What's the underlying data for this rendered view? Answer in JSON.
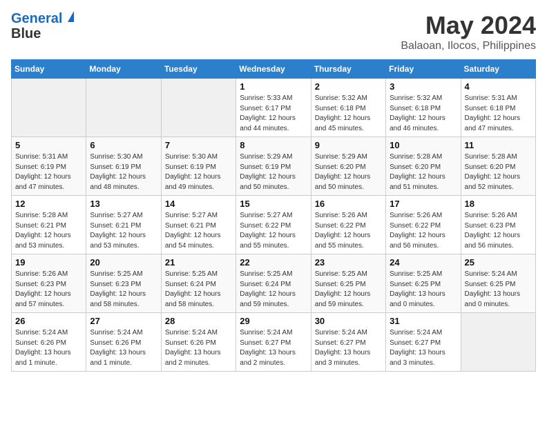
{
  "header": {
    "logo_line1": "General",
    "logo_line2": "Blue",
    "month": "May 2024",
    "location": "Balaoan, Ilocos, Philippines"
  },
  "days_of_week": [
    "Sunday",
    "Monday",
    "Tuesday",
    "Wednesday",
    "Thursday",
    "Friday",
    "Saturday"
  ],
  "weeks": [
    [
      {
        "num": "",
        "info": ""
      },
      {
        "num": "",
        "info": ""
      },
      {
        "num": "",
        "info": ""
      },
      {
        "num": "1",
        "info": "Sunrise: 5:33 AM\nSunset: 6:17 PM\nDaylight: 12 hours\nand 44 minutes."
      },
      {
        "num": "2",
        "info": "Sunrise: 5:32 AM\nSunset: 6:18 PM\nDaylight: 12 hours\nand 45 minutes."
      },
      {
        "num": "3",
        "info": "Sunrise: 5:32 AM\nSunset: 6:18 PM\nDaylight: 12 hours\nand 46 minutes."
      },
      {
        "num": "4",
        "info": "Sunrise: 5:31 AM\nSunset: 6:18 PM\nDaylight: 12 hours\nand 47 minutes."
      }
    ],
    [
      {
        "num": "5",
        "info": "Sunrise: 5:31 AM\nSunset: 6:19 PM\nDaylight: 12 hours\nand 47 minutes."
      },
      {
        "num": "6",
        "info": "Sunrise: 5:30 AM\nSunset: 6:19 PM\nDaylight: 12 hours\nand 48 minutes."
      },
      {
        "num": "7",
        "info": "Sunrise: 5:30 AM\nSunset: 6:19 PM\nDaylight: 12 hours\nand 49 minutes."
      },
      {
        "num": "8",
        "info": "Sunrise: 5:29 AM\nSunset: 6:19 PM\nDaylight: 12 hours\nand 50 minutes."
      },
      {
        "num": "9",
        "info": "Sunrise: 5:29 AM\nSunset: 6:20 PM\nDaylight: 12 hours\nand 50 minutes."
      },
      {
        "num": "10",
        "info": "Sunrise: 5:28 AM\nSunset: 6:20 PM\nDaylight: 12 hours\nand 51 minutes."
      },
      {
        "num": "11",
        "info": "Sunrise: 5:28 AM\nSunset: 6:20 PM\nDaylight: 12 hours\nand 52 minutes."
      }
    ],
    [
      {
        "num": "12",
        "info": "Sunrise: 5:28 AM\nSunset: 6:21 PM\nDaylight: 12 hours\nand 53 minutes."
      },
      {
        "num": "13",
        "info": "Sunrise: 5:27 AM\nSunset: 6:21 PM\nDaylight: 12 hours\nand 53 minutes."
      },
      {
        "num": "14",
        "info": "Sunrise: 5:27 AM\nSunset: 6:21 PM\nDaylight: 12 hours\nand 54 minutes."
      },
      {
        "num": "15",
        "info": "Sunrise: 5:27 AM\nSunset: 6:22 PM\nDaylight: 12 hours\nand 55 minutes."
      },
      {
        "num": "16",
        "info": "Sunrise: 5:26 AM\nSunset: 6:22 PM\nDaylight: 12 hours\nand 55 minutes."
      },
      {
        "num": "17",
        "info": "Sunrise: 5:26 AM\nSunset: 6:22 PM\nDaylight: 12 hours\nand 56 minutes."
      },
      {
        "num": "18",
        "info": "Sunrise: 5:26 AM\nSunset: 6:23 PM\nDaylight: 12 hours\nand 56 minutes."
      }
    ],
    [
      {
        "num": "19",
        "info": "Sunrise: 5:26 AM\nSunset: 6:23 PM\nDaylight: 12 hours\nand 57 minutes."
      },
      {
        "num": "20",
        "info": "Sunrise: 5:25 AM\nSunset: 6:23 PM\nDaylight: 12 hours\nand 58 minutes."
      },
      {
        "num": "21",
        "info": "Sunrise: 5:25 AM\nSunset: 6:24 PM\nDaylight: 12 hours\nand 58 minutes."
      },
      {
        "num": "22",
        "info": "Sunrise: 5:25 AM\nSunset: 6:24 PM\nDaylight: 12 hours\nand 59 minutes."
      },
      {
        "num": "23",
        "info": "Sunrise: 5:25 AM\nSunset: 6:25 PM\nDaylight: 12 hours\nand 59 minutes."
      },
      {
        "num": "24",
        "info": "Sunrise: 5:25 AM\nSunset: 6:25 PM\nDaylight: 13 hours\nand 0 minutes."
      },
      {
        "num": "25",
        "info": "Sunrise: 5:24 AM\nSunset: 6:25 PM\nDaylight: 13 hours\nand 0 minutes."
      }
    ],
    [
      {
        "num": "26",
        "info": "Sunrise: 5:24 AM\nSunset: 6:26 PM\nDaylight: 13 hours\nand 1 minute."
      },
      {
        "num": "27",
        "info": "Sunrise: 5:24 AM\nSunset: 6:26 PM\nDaylight: 13 hours\nand 1 minute."
      },
      {
        "num": "28",
        "info": "Sunrise: 5:24 AM\nSunset: 6:26 PM\nDaylight: 13 hours\nand 2 minutes."
      },
      {
        "num": "29",
        "info": "Sunrise: 5:24 AM\nSunset: 6:27 PM\nDaylight: 13 hours\nand 2 minutes."
      },
      {
        "num": "30",
        "info": "Sunrise: 5:24 AM\nSunset: 6:27 PM\nDaylight: 13 hours\nand 3 minutes."
      },
      {
        "num": "31",
        "info": "Sunrise: 5:24 AM\nSunset: 6:27 PM\nDaylight: 13 hours\nand 3 minutes."
      },
      {
        "num": "",
        "info": ""
      }
    ]
  ]
}
